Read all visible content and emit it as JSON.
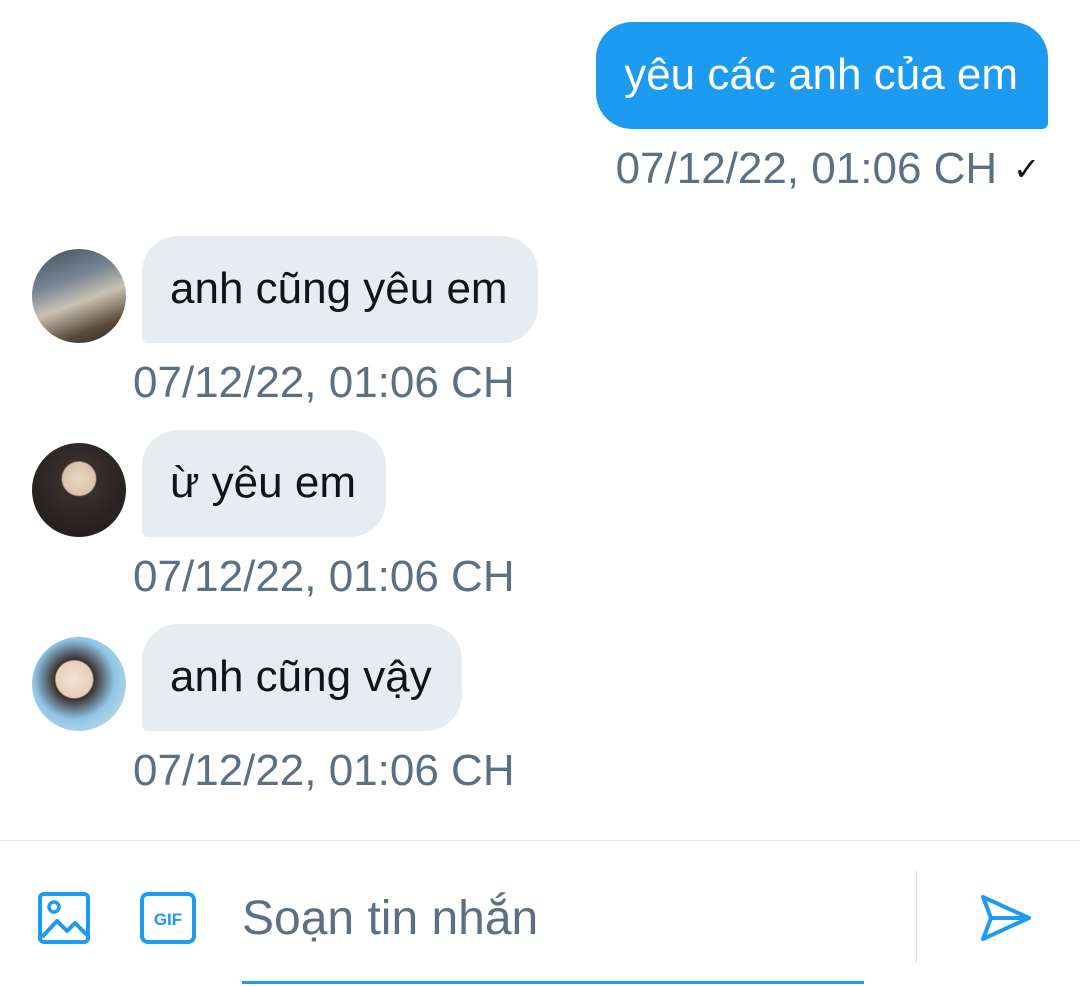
{
  "conversation": {
    "sent": [
      {
        "text": "yêu các anh của em",
        "timestamp": "07/12/22, 01:06 CH",
        "status_icon": "check-icon"
      }
    ],
    "received": [
      {
        "text": "anh cũng yêu em",
        "timestamp": "07/12/22, 01:06 CH",
        "avatar": "avatar-1"
      },
      {
        "text": "ừ yêu em",
        "timestamp": "07/12/22, 01:06 CH",
        "avatar": "avatar-2"
      },
      {
        "text": "anh cũng vậy",
        "timestamp": "07/12/22, 01:06 CH",
        "avatar": "avatar-3"
      }
    ]
  },
  "composer": {
    "placeholder": "Soạn tin nhắn",
    "media_icon": "image-icon",
    "gif_icon": "gif-icon",
    "gif_label": "GIF",
    "send_icon": "send-icon"
  },
  "colors": {
    "accent": "#1d9bf0",
    "received_bubble": "#e7ecf0",
    "muted_text": "#5b7083",
    "primary_text": "#0f1419"
  }
}
